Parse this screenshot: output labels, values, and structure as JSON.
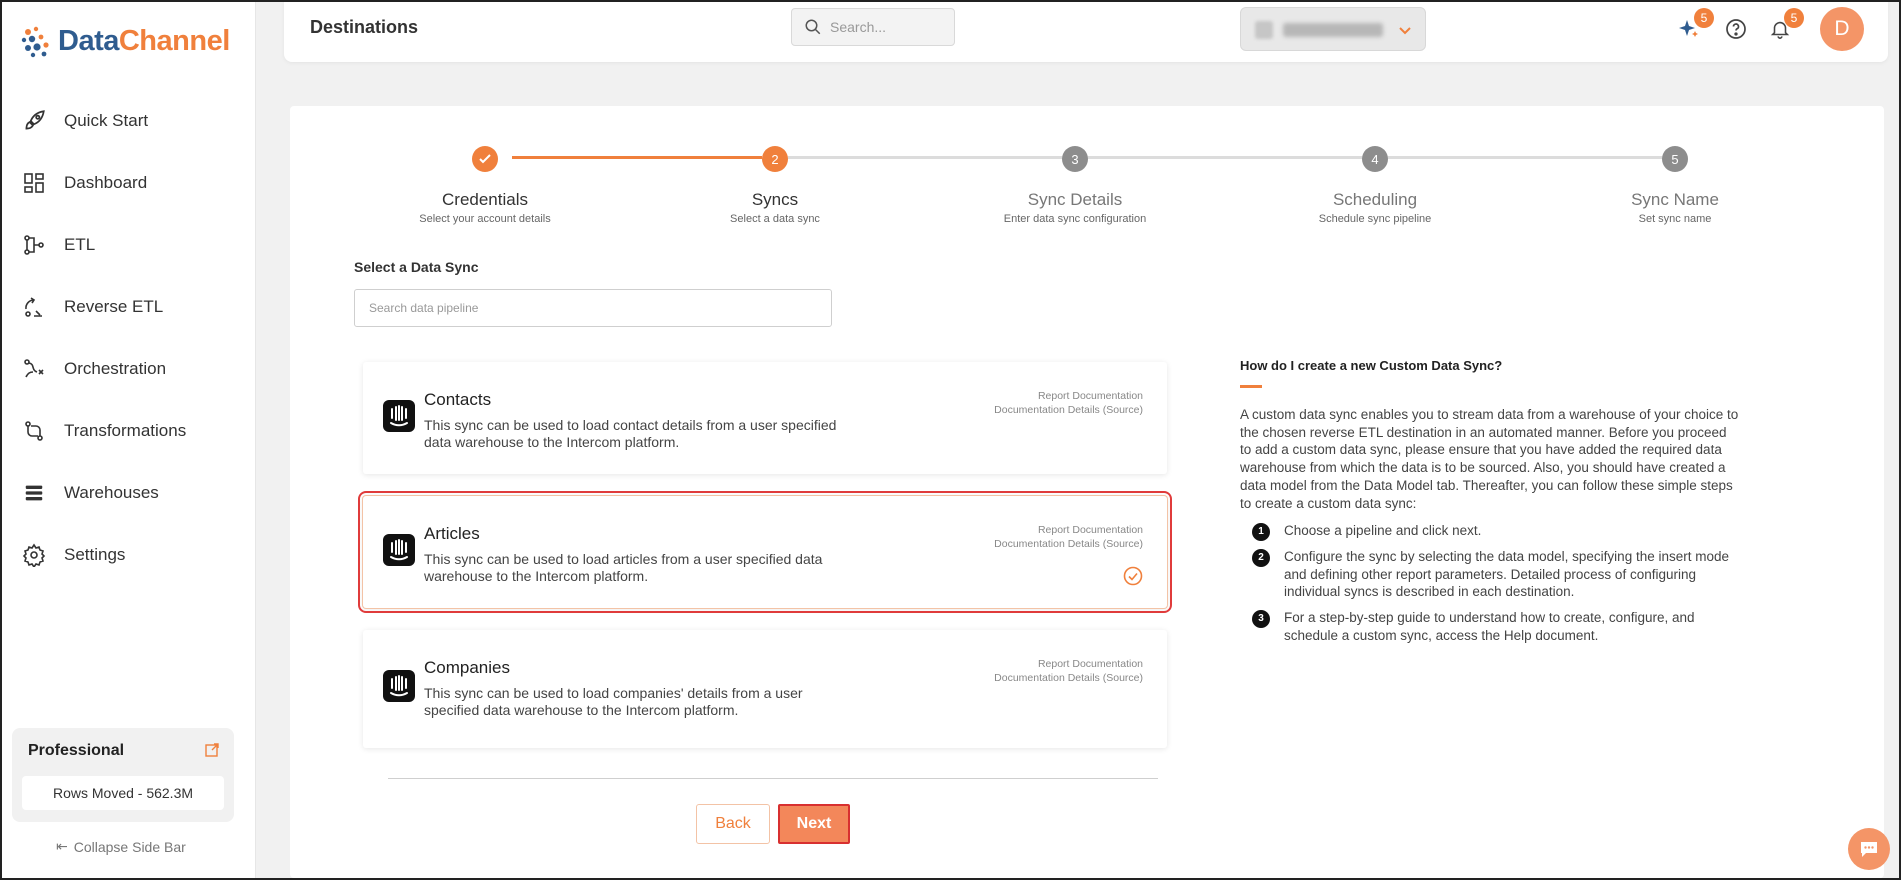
{
  "brand": {
    "name_part1": "Data",
    "name_part2": "Channel"
  },
  "sidebar": {
    "items": [
      {
        "label": "Quick Start",
        "icon": "rocket-icon"
      },
      {
        "label": "Dashboard",
        "icon": "dashboard-icon"
      },
      {
        "label": "ETL",
        "icon": "etl-icon"
      },
      {
        "label": "Reverse ETL",
        "icon": "reverse-etl-icon"
      },
      {
        "label": "Orchestration",
        "icon": "orchestration-icon"
      },
      {
        "label": "Transformations",
        "icon": "transformations-icon"
      },
      {
        "label": "Warehouses",
        "icon": "warehouses-icon"
      },
      {
        "label": "Settings",
        "icon": "gear-icon"
      }
    ],
    "plan": {
      "title": "Professional",
      "rows_moved": "Rows Moved - 562.3M"
    },
    "collapse_label": "Collapse Side Bar"
  },
  "header": {
    "title": "Destinations",
    "search_placeholder": "Search...",
    "ai_badge": "5",
    "notifications_badge": "5",
    "avatar_initial": "D"
  },
  "stepper": {
    "steps": [
      {
        "number": "1",
        "title": "Credentials",
        "subtitle": "Select your account details",
        "state": "done"
      },
      {
        "number": "2",
        "title": "Syncs",
        "subtitle": "Select a data sync",
        "state": "current"
      },
      {
        "number": "3",
        "title": "Sync Details",
        "subtitle": "Enter data sync configuration",
        "state": "pending"
      },
      {
        "number": "4",
        "title": "Scheduling",
        "subtitle": "Schedule sync pipeline",
        "state": "pending"
      },
      {
        "number": "5",
        "title": "Sync Name",
        "subtitle": "Set sync name",
        "state": "pending"
      }
    ]
  },
  "select_sync": {
    "label": "Select a Data Sync",
    "search_placeholder": "Search data pipeline"
  },
  "syncs": [
    {
      "name": "Contacts",
      "description": "This sync can be used to load contact details from a user specified data warehouse to the Intercom platform.",
      "link1": "Report Documentation",
      "link2": "Documentation Details (Source)",
      "selected": false
    },
    {
      "name": "Articles",
      "description": "This sync can be used to load articles from a user specified data warehouse to the Intercom platform.",
      "link1": "Report Documentation",
      "link2": "Documentation Details (Source)",
      "selected": true
    },
    {
      "name": "Companies",
      "description": "This sync can be used to load companies' details from a user specified data warehouse to the Intercom platform.",
      "link1": "Report Documentation",
      "link2": "Documentation Details (Source)",
      "selected": false
    }
  ],
  "buttons": {
    "back": "Back",
    "next": "Next"
  },
  "help": {
    "title": "How do I create a new Custom Data Sync?",
    "paragraph": "A custom data sync enables you to stream data from a warehouse of your choice to the chosen reverse ETL destination in an automated manner. Before you proceed to add a custom data sync, please ensure that you have added the required data warehouse from which the data is to be sourced. Also, you should have created a data model from the Data Model tab. Thereafter, you can follow these simple steps to create a custom data sync:",
    "steps": [
      {
        "num": "1",
        "text": "Choose a pipeline and click next."
      },
      {
        "num": "2",
        "text": "Configure the sync by selecting the data model, specifying the insert mode and defining other report parameters. Detailed process of configuring individual syncs is described in each destination."
      },
      {
        "num": "3",
        "text": "For a step-by-step guide to understand how to create, configure, and schedule a custom sync, access the Help document."
      }
    ]
  },
  "colors": {
    "accent": "#f0803c",
    "selection_outline": "#e03b3b",
    "brand_blue": "#2f5c8f"
  }
}
